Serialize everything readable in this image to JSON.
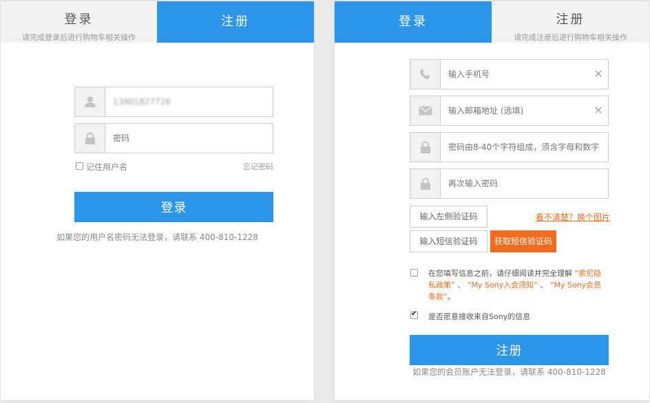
{
  "login": {
    "tab_login": {
      "title": "登录",
      "subtitle": "请完成登录后进行购物车相关操作"
    },
    "tab_register": {
      "title": "注册"
    },
    "username_value": "13901827726",
    "password_placeholder": "密码",
    "remember_label": "记住用户名",
    "forgot_link": "忘记密码",
    "submit_label": "登录",
    "help_text": "如果您的用户名密码无法登录，请联系 400-810-1228"
  },
  "register": {
    "tab_login": {
      "title": "登录"
    },
    "tab_register": {
      "title": "注册",
      "subtitle": "请完成注册后进行购物车相关操作"
    },
    "phone_placeholder": "输入手机号",
    "email_placeholder": "输入邮箱地址 (选填)",
    "password_placeholder": "密码由8-40个字符组成，须含字母和数字",
    "confirm_placeholder": "再次输入密码",
    "captcha_placeholder": "输入左侧验证码",
    "refresh_link": "看不清楚？换个图片",
    "sms_placeholder": "输入短信验证码",
    "sms_button": "获取短信验证码",
    "agree_prefix": "在您填写信息之前，请仔细阅读并完全理解",
    "agree_policy1": "“索尼隐私政策”",
    "agree_sep1": "、",
    "agree_policy2": "“My Sony入会须知”",
    "agree_sep2": "、",
    "agree_policy3": "“My Sony会员条款”",
    "agree_end": "。",
    "newsletter_label": "是否愿意接收来自Sony的信息",
    "submit_label": "注册",
    "help_text": "如果您的会员账户无法登录，请联系 400-810-1228"
  },
  "colors": {
    "accent": "#2b95ea",
    "orange": "#f26b1d"
  }
}
